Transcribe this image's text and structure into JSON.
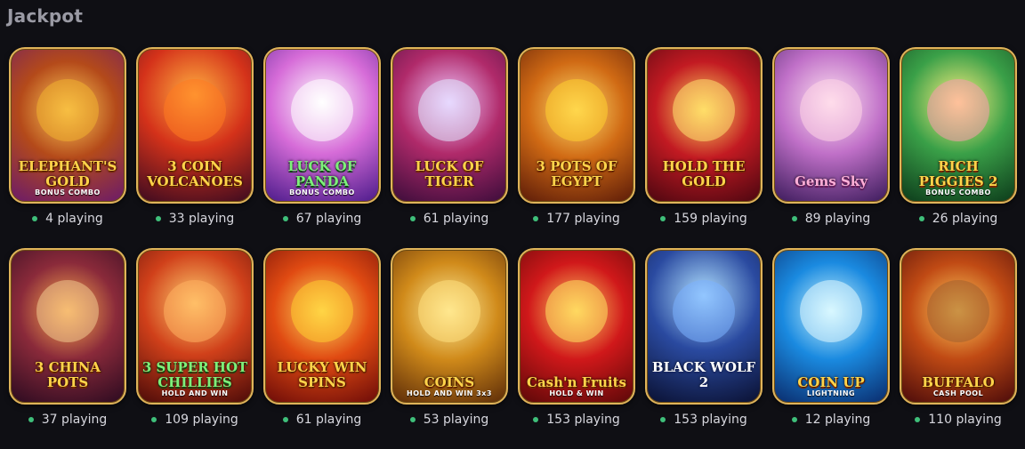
{
  "section": {
    "title": "Jackpot"
  },
  "games": [
    {
      "title": "ELEPHANT'S GOLD",
      "subtitle": "BONUS COMBO",
      "playing": "4 playing",
      "icon": "elephant-icon"
    },
    {
      "title": "3 COIN VOLCANOES",
      "subtitle": "",
      "playing": "33 playing",
      "icon": "volcano-icon"
    },
    {
      "title": "LUCK OF PANDA",
      "subtitle": "BONUS COMBO",
      "playing": "67 playing",
      "icon": "panda-icon"
    },
    {
      "title": "LUCK OF TIGER",
      "subtitle": "",
      "playing": "61 playing",
      "icon": "tiger-icon"
    },
    {
      "title": "3 POTS OF EGYPT",
      "subtitle": "",
      "playing": "177 playing",
      "icon": "gold-pot-icon"
    },
    {
      "title": "HOLD THE GOLD",
      "subtitle": "",
      "playing": "159 playing",
      "icon": "mini-coin-icon"
    },
    {
      "title": "Gems Sky",
      "subtitle": "",
      "playing": "89 playing",
      "icon": "princess-icon"
    },
    {
      "title": "RICH PIGGIES 2",
      "subtitle": "BONUS COMBO",
      "playing": "26 playing",
      "icon": "piggy-icon"
    },
    {
      "title": "3 CHINA POTS",
      "subtitle": "",
      "playing": "37 playing",
      "icon": "lady-icon"
    },
    {
      "title": "3 SUPER HOT CHILLIES",
      "subtitle": "HOLD AND WIN",
      "playing": "109 playing",
      "icon": "chef-icon"
    },
    {
      "title": "LUCKY WIN SPINS",
      "subtitle": "",
      "playing": "61 playing",
      "icon": "lucky-seven-icon"
    },
    {
      "title": "COINS",
      "subtitle": "HOLD AND WIN 3x3",
      "playing": "53 playing",
      "icon": "coin-icon"
    },
    {
      "title": "Cash'n Fruits",
      "subtitle": "HOLD & WIN",
      "playing": "153 playing",
      "icon": "seven-mini-icon"
    },
    {
      "title": "BLACK WOLF 2",
      "subtitle": "",
      "playing": "153 playing",
      "icon": "wolf-icon"
    },
    {
      "title": "COIN UP",
      "subtitle": "LIGHTNING",
      "playing": "12 playing",
      "icon": "up-coin-icon"
    },
    {
      "title": "BUFFALO",
      "subtitle": "CASH POOL",
      "playing": "110 playing",
      "icon": "buffalo-icon"
    }
  ]
}
